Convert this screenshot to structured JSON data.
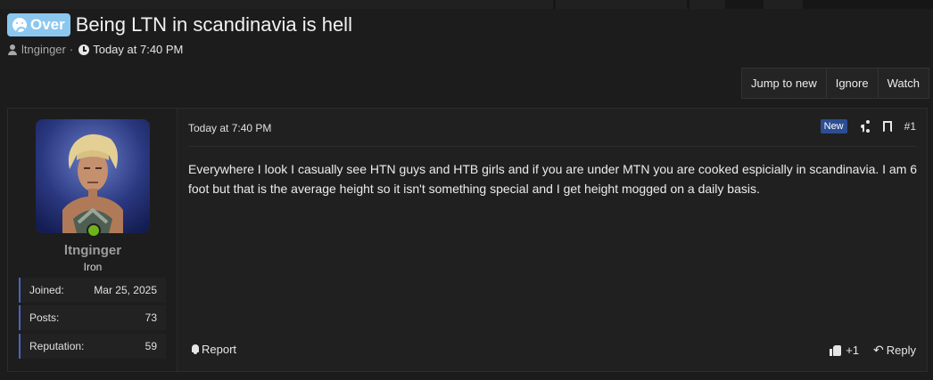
{
  "thread": {
    "prefix": "Over",
    "title": "Being LTN in scandinavia is hell",
    "author": "ltnginger",
    "separator": "·",
    "time": "Today at 7:40 PM"
  },
  "actions": {
    "jump": "Jump to new",
    "ignore": "Ignore",
    "watch": "Watch"
  },
  "post": {
    "time": "Today at 7:40 PM",
    "new_badge": "New",
    "number": "#1",
    "body": "Everywhere I look I casually see HTN guys and HTB girls and if you are under MTN you are cooked espicially in scandinavia. I am 6 foot but that is the average height so it isn't something special and I get height mogged on a daily basis.",
    "report": "Report",
    "likes": "+1",
    "reply": "Reply"
  },
  "user": {
    "name": "ltnginger",
    "title": "Iron",
    "stats": [
      {
        "label": "Joined:",
        "value": "Mar 25, 2025"
      },
      {
        "label": "Posts:",
        "value": "73"
      },
      {
        "label": "Reputation:",
        "value": "59"
      }
    ]
  },
  "colors": {
    "prefix_bg": "#8bc7ee",
    "new_badge_bg": "#2c4d92",
    "online": "#6fb31b",
    "stat_accent": "#4a63c4"
  }
}
